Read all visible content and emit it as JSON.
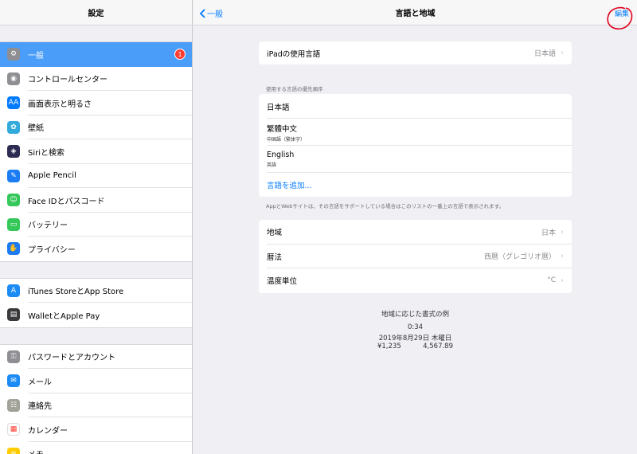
{
  "sidebar": {
    "title": "設定",
    "groups": [
      [
        {
          "label": "一般",
          "icon": "gear-icon",
          "color": "#8e8e93",
          "glyph": "⚙",
          "selected": true,
          "badge": "1"
        },
        {
          "label": "コントロールセンター",
          "icon": "toggles-icon",
          "color": "#8e8e93",
          "glyph": "◉"
        },
        {
          "label": "画面表示と明るさ",
          "icon": "text-size-icon",
          "color": "#007aff",
          "glyph": "AA"
        },
        {
          "label": "壁紙",
          "icon": "wallpaper-flower-icon",
          "color": "#34aadc",
          "glyph": "✿"
        },
        {
          "label": "Siriと検索",
          "icon": "siri-icon",
          "color": "#2c2c54",
          "glyph": "◈"
        },
        {
          "label": "Apple Pencil",
          "icon": "pencil-icon",
          "color": "#1c7cf4",
          "glyph": "✎"
        },
        {
          "label": "Face IDとパスコード",
          "icon": "face-id-icon",
          "color": "#34c759",
          "glyph": "☺"
        },
        {
          "label": "バッテリー",
          "icon": "battery-icon",
          "color": "#34c759",
          "glyph": "▭"
        },
        {
          "label": "プライバシー",
          "icon": "hand-icon",
          "color": "#1c7cf4",
          "glyph": "✋"
        }
      ],
      [
        {
          "label": "iTunes StoreとApp Store",
          "icon": "app-store-icon",
          "color": "#1c8cf4",
          "glyph": "A"
        },
        {
          "label": "WalletとApple Pay",
          "icon": "wallet-icon",
          "color": "#3a3a3c",
          "glyph": "▤"
        }
      ],
      [
        {
          "label": "パスワードとアカウント",
          "icon": "key-icon",
          "color": "#8e8e93",
          "glyph": "⚿"
        },
        {
          "label": "メール",
          "icon": "mail-icon",
          "color": "#1c8cf4",
          "glyph": "✉"
        },
        {
          "label": "連絡先",
          "icon": "contacts-icon",
          "color": "#a2a29a",
          "glyph": "☷"
        },
        {
          "label": "カレンダー",
          "icon": "calendar-icon",
          "color": "#ffffff",
          "glyph": "▦"
        },
        {
          "label": "メモ",
          "icon": "notes-icon",
          "color": "#ffcc00",
          "glyph": "≡"
        }
      ]
    ]
  },
  "navbar": {
    "back_label": "一般",
    "title": "言語と地域",
    "edit_label": "編集"
  },
  "device_language": {
    "label": "iPadの使用言語",
    "value": "日本語"
  },
  "preferred": {
    "section_label": "使用する言語の優先順序",
    "languages": [
      {
        "name": "日本語",
        "sub": ""
      },
      {
        "name": "繁體中文",
        "sub": "中国語（繁体字）"
      },
      {
        "name": "English",
        "sub": "英語"
      }
    ],
    "add_label": "言語を追加...",
    "footnote": "AppとWebサイトは、その言語をサポートしている場合はこのリストの一番上の言語で表示されます。"
  },
  "region_settings": [
    {
      "label": "地域",
      "value": "日本"
    },
    {
      "label": "暦法",
      "value": "西暦（グレゴリオ暦）"
    },
    {
      "label": "温度単位",
      "value": "°C"
    }
  ],
  "format_example": {
    "title": "地域に応じた書式の例",
    "time": "0:34",
    "date": "2019年8月29日 木曜日",
    "currency": "¥1,235",
    "number": "4,567.89"
  },
  "colors": {
    "accent": "#007aff",
    "selected": "#4a9df8",
    "badge": "#ff3b30",
    "annotation": "#e0001a"
  }
}
